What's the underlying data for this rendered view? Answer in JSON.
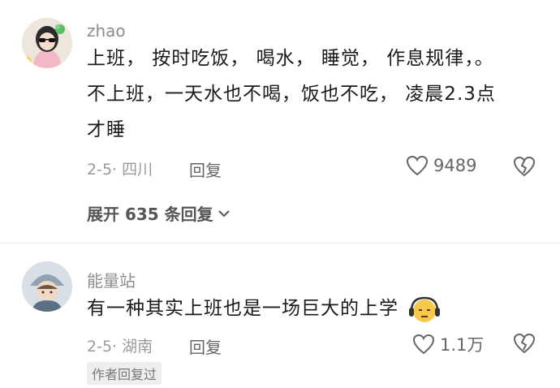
{
  "comments": [
    {
      "username": "zhao",
      "text_line1": "上班， 按时吃饭， 喝水， 睡觉， 作息规律，。",
      "text_line2": "不上班，一天水也不喝，饭也不吃， 凌晨2.3点",
      "text_line3": "才睡",
      "date_location": "2-5· 四川",
      "reply_label": "回复",
      "like_count": "9489",
      "expand_label": "展开 635 条回复",
      "avatar_icon": "girl-with-sunglasses-avatar"
    },
    {
      "username": "能量站",
      "text": "有一种其实上班也是一场巨大的上学",
      "emoji_icon": "sleepy-face-with-headphones-emoji",
      "date_location": "2-5· 湖南",
      "reply_label": "回复",
      "like_count": "1.1万",
      "badge": "作者回复过",
      "avatar_icon": "child-with-hat-avatar"
    }
  ],
  "colors": {
    "text": "#1a1a1a",
    "meta": "#9a9a9a",
    "badge_bg": "#eeeeee"
  }
}
